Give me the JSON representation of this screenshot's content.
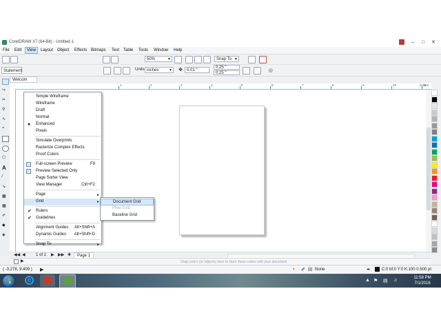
{
  "window": {
    "title": "CorelDRAW X7 (64-Bit) - Untitled-1"
  },
  "menubar": {
    "items": [
      "File",
      "Edit",
      "View",
      "Layout",
      "Object",
      "Effects",
      "Bitmaps",
      "Text",
      "Table",
      "Tools",
      "Window",
      "Help"
    ]
  },
  "toolbar": {
    "zoom": "50%",
    "snap_to": "Snap To",
    "units_label": "Units:",
    "units": "inches",
    "nudge": "0.01 \"",
    "dup_x": "0.25 \"",
    "dup_y": "0.25 \"",
    "statement": "Statement"
  },
  "tab": {
    "label": "Welcom"
  },
  "ruler": {
    "h_labels": [
      "1",
      "2",
      "3",
      "4",
      "5",
      "6",
      "7",
      "8",
      "9",
      "10",
      "11",
      "12"
    ],
    "unit": "inches"
  },
  "view_menu": {
    "items": [
      {
        "label": "Simple Wireframe",
        "shortcut": "",
        "mark": ""
      },
      {
        "label": "Wireframe",
        "shortcut": "",
        "mark": ""
      },
      {
        "label": "Draft",
        "shortcut": "",
        "mark": ""
      },
      {
        "label": "Normal",
        "shortcut": "",
        "mark": ""
      },
      {
        "label": "Enhanced",
        "shortcut": "",
        "mark": "bullet"
      },
      {
        "label": "Pixels",
        "shortcut": "",
        "mark": ""
      },
      {
        "label": "Simulate Overprints",
        "shortcut": "",
        "mark": ""
      },
      {
        "label": "Rasterize Complex Effects",
        "shortcut": "",
        "mark": ""
      },
      {
        "label": "Proof Colors",
        "shortcut": "",
        "mark": ""
      },
      {
        "label": "Full-screen Preview",
        "shortcut": "F9",
        "mark": "icon"
      },
      {
        "label": "Preview Selected Only",
        "shortcut": "",
        "mark": "icon"
      },
      {
        "label": "Page Sorter View",
        "shortcut": "",
        "mark": ""
      },
      {
        "label": "View Manager",
        "shortcut": "Ctrl+F2",
        "mark": ""
      },
      {
        "label": "Page",
        "shortcut": "",
        "mark": "",
        "submenu": true
      },
      {
        "label": "Grid",
        "shortcut": "",
        "mark": "",
        "submenu": true
      },
      {
        "label": "Rulers",
        "shortcut": "",
        "mark": "check"
      },
      {
        "label": "Guidelines",
        "shortcut": "",
        "mark": "check"
      },
      {
        "label": "Alignment Guides",
        "shortcut": "Alt+Shift+A",
        "mark": ""
      },
      {
        "label": "Dynamic Guides",
        "shortcut": "Alt+Shift+D",
        "mark": ""
      },
      {
        "label": "Snap To",
        "shortcut": "",
        "mark": "",
        "submenu": true
      }
    ]
  },
  "grid_submenu": {
    "items": [
      {
        "label": "Document Grid",
        "enabled": true
      },
      {
        "label": "Pixel Grid",
        "enabled": false
      },
      {
        "label": "Baseline Grid",
        "enabled": true
      }
    ]
  },
  "pages": {
    "counter": "1 of 1",
    "tab": "Page 1"
  },
  "colorbar": {
    "hint": "Drag colors (or objects) here to store these colors with your document"
  },
  "status": {
    "coords": "( -3.278, 9.409 )",
    "fill": "None",
    "outline": "C:0 M:0 Y:0 K:100  0.500 pt"
  },
  "palette": {
    "colors": [
      "#ffffff",
      "#000000",
      "#e6e6e6",
      "#cccccc",
      "#b3b3b3",
      "#999999",
      "#808080",
      "#00a0e3",
      "#0072bc",
      "#00a651",
      "#8dc63f",
      "#fff200",
      "#f7941d",
      "#ed1c24",
      "#ec008c",
      "#92278f",
      "#f49ac1",
      "#c2b59b",
      "#998675",
      "#736357",
      "#ffffff",
      "#d9d9d9",
      "#bfbfbf",
      "#a6a6a6",
      "#8c8c8c"
    ]
  },
  "taskbar": {
    "time": "11:58 PM",
    "date": "7/1/2016"
  }
}
